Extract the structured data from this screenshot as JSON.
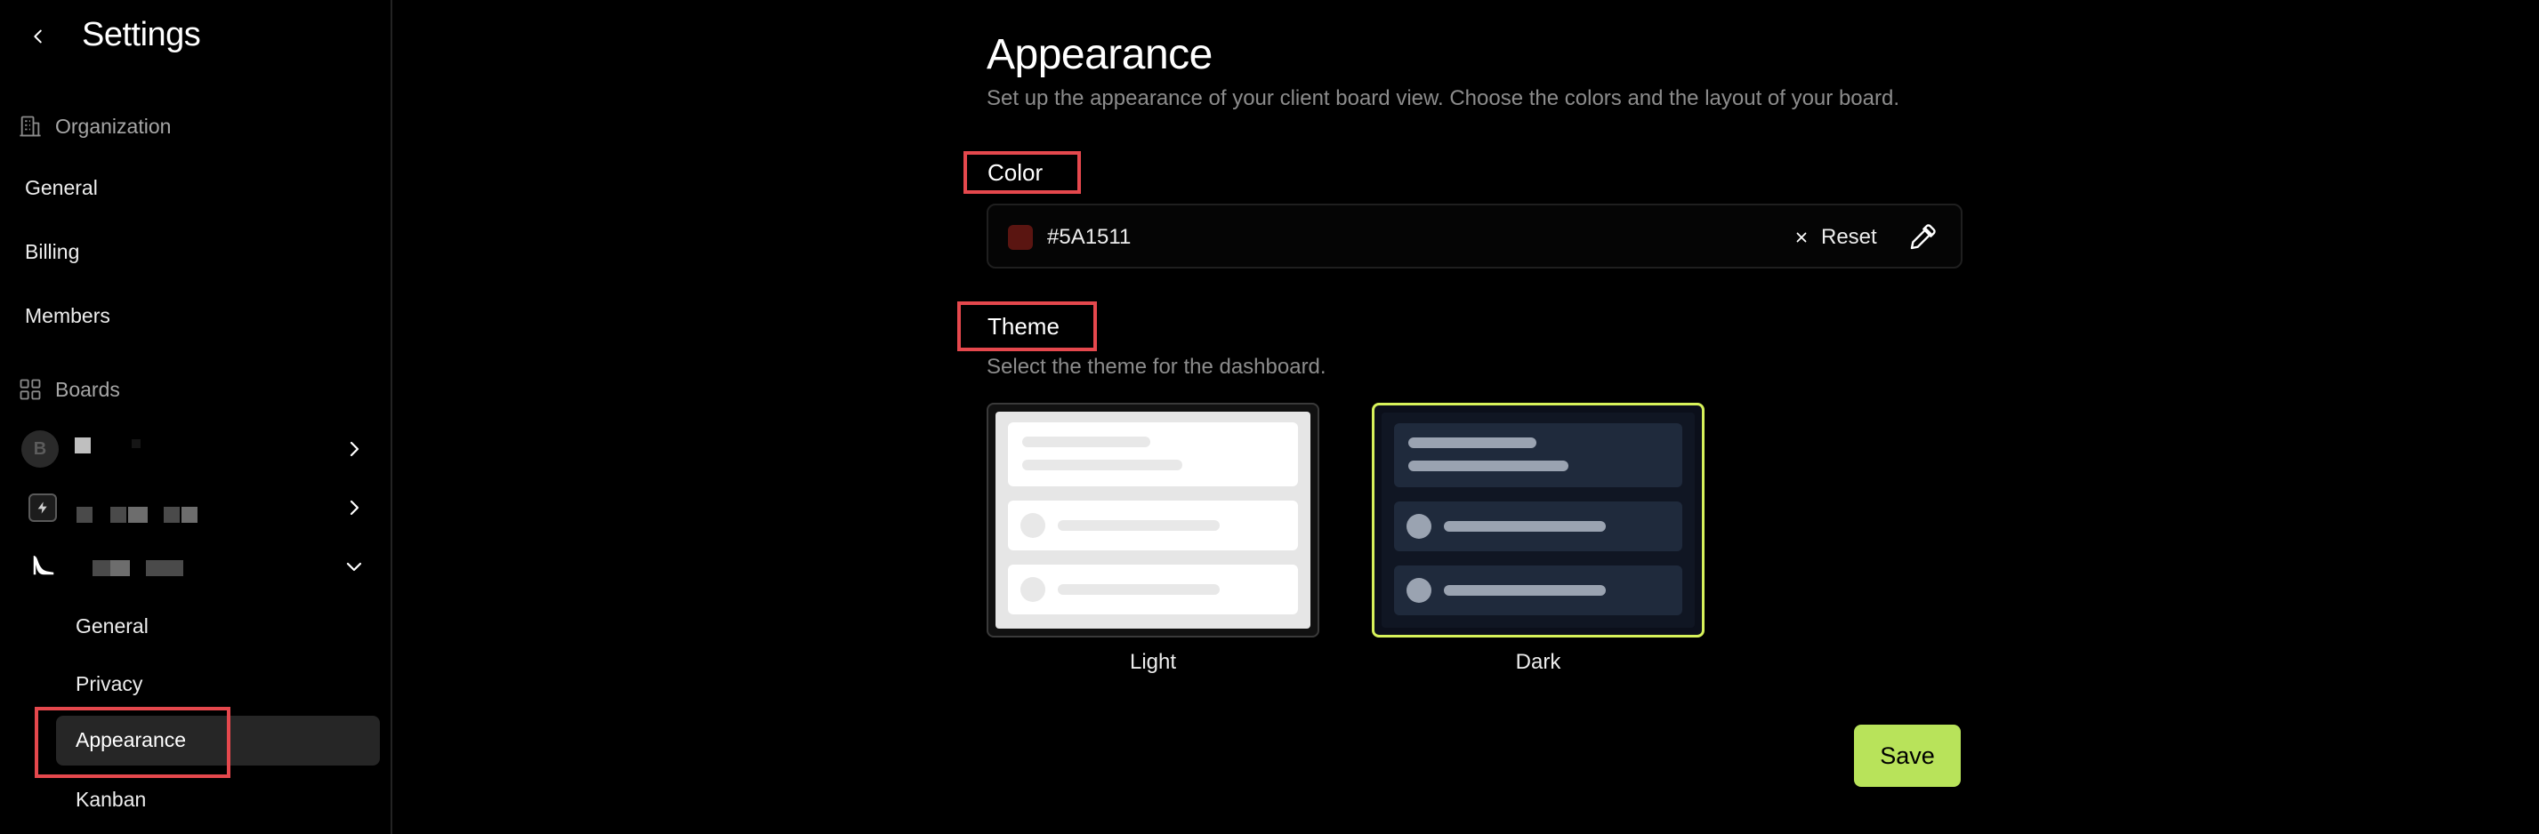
{
  "sidebar": {
    "title": "Settings",
    "organization": {
      "label": "Organization",
      "items": [
        {
          "label": "General"
        },
        {
          "label": "Billing"
        },
        {
          "label": "Members"
        }
      ]
    },
    "boards": {
      "label": "Boards",
      "first_avatar_letter": "B",
      "sub_items": [
        {
          "label": "General"
        },
        {
          "label": "Privacy"
        },
        {
          "label": "Appearance"
        },
        {
          "label": "Kanban"
        }
      ]
    }
  },
  "main": {
    "title": "Appearance",
    "description": "Set up the appearance of your client board view. Choose the colors and the layout of your board.",
    "color": {
      "label": "Color",
      "value": "#5A1511",
      "swatch_color": "#5A1511",
      "reset_label": "Reset"
    },
    "theme": {
      "label": "Theme",
      "description": "Select the theme for the dashboard.",
      "options": [
        {
          "label": "Light",
          "selected": false
        },
        {
          "label": "Dark",
          "selected": true
        }
      ]
    },
    "save_label": "Save"
  },
  "colors": {
    "accent": "#B8E35A",
    "selected_border": "#D7F25A",
    "highlight": "#E5484D"
  }
}
